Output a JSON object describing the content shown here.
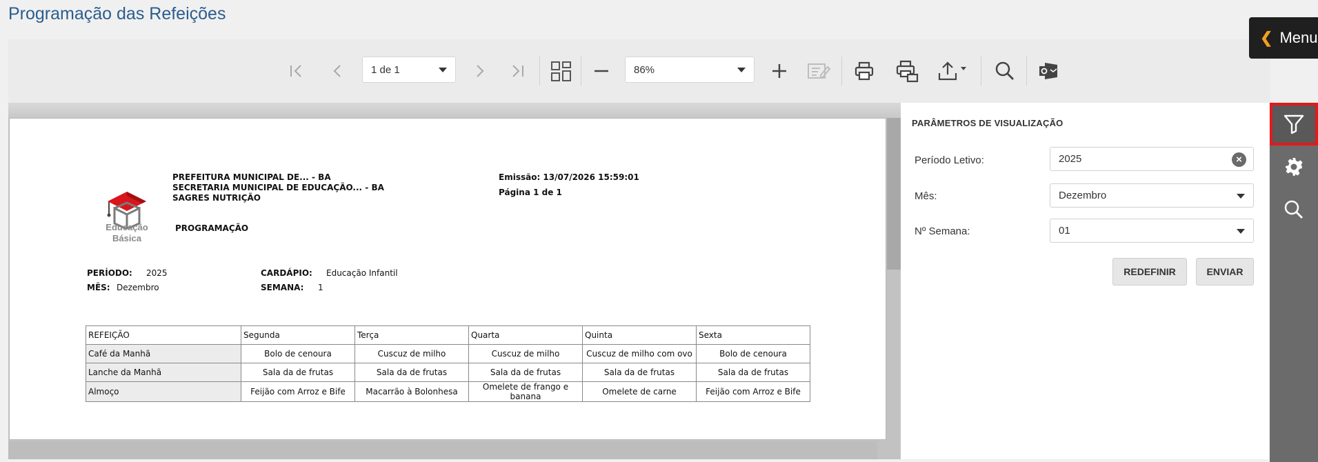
{
  "page": {
    "title": "Programação das Refeições"
  },
  "menu": {
    "label": "Menu",
    "icon": "chevron-left-icon"
  },
  "toolbar": {
    "page_selector": "1 de 1",
    "zoom": "86%",
    "icons": [
      "first-page-icon",
      "previous-page-icon",
      "next-page-icon",
      "last-page-icon",
      "multipage-icon",
      "zoom-out-icon",
      "zoom-in-icon",
      "edit-icon",
      "print-icon",
      "print-page-icon",
      "export-icon",
      "search-icon",
      "outlook-icon"
    ]
  },
  "report": {
    "logo_text": "Educação Básica",
    "header_lines": [
      "PREFEITURA MUNICIPAL DE... - BA",
      "SECRETARIA MUNICIPAL DE EDUCAÇÃO... - BA",
      "SAGRES NUTRIÇÃO"
    ],
    "subtitle": "PROGRAMAÇÃO",
    "emission": "Emissão: 13/07/2026 15:59:01",
    "page_info": "Página 1 de 1",
    "periodo_label": "PERÍODO:",
    "periodo_value": "2025",
    "cardapio_label": "CARDÁPIO:",
    "cardapio_value": "Educação Infantil",
    "mes_label": "MÊS:",
    "mes_value": "Dezembro",
    "semana_label": "SEMANA:",
    "semana_value": "1",
    "table": {
      "headers": [
        "REFEIÇÃO",
        "Segunda",
        "Terça",
        "Quarta",
        "Quinta",
        "Sexta"
      ],
      "rows": [
        [
          "Café da Manhã",
          "Bolo de cenoura",
          "Cuscuz de milho",
          "Cuscuz de milho",
          "Cuscuz de milho com ovo",
          "Bolo de cenoura"
        ],
        [
          "Lanche da Manhã",
          "Sala da de frutas",
          "Sala da de frutas",
          "Sala da de frutas",
          "Sala da de frutas",
          "Sala da de frutas"
        ],
        [
          "Almoço",
          "Feijão com Arroz e Bife",
          "Macarrão à Bolonhesa",
          "Omelete de frango e banana",
          "Omelete de carne",
          "Feijão com Arroz e Bife"
        ]
      ]
    }
  },
  "panel": {
    "title": "PARÂMETROS DE VISUALIZAÇÃO",
    "periodo_label": "Período Letivo:",
    "periodo_value": "2025",
    "mes_label": "Mês:",
    "mes_value": "Dezembro",
    "semana_label": "Nº Semana:",
    "semana_value": "01",
    "reset_label": "REDEFINIR",
    "submit_label": "ENVIAR"
  },
  "rail": {
    "items": [
      "filter-icon",
      "gear-icon",
      "search-icon"
    ],
    "active": "filter-icon",
    "highlight_color": "#e3191b"
  }
}
